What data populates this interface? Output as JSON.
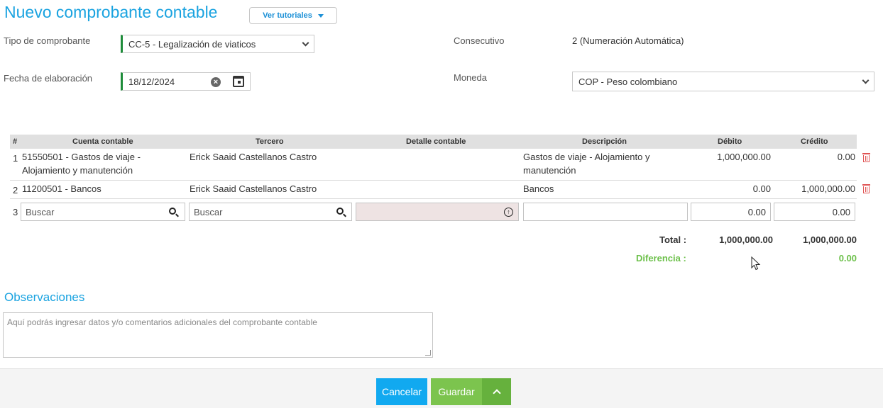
{
  "header": {
    "title": "Nuevo comprobante contable",
    "tutorials_label": "Ver tutoriales"
  },
  "form": {
    "tipo_label": "Tipo de comprobante",
    "tipo_value": "CC-5 - Legalización de viaticos",
    "consecutivo_label": "Consecutivo",
    "consecutivo_value": "2 (Numeración Automática)",
    "fecha_label": "Fecha de elaboración",
    "fecha_value": "18/12/2024",
    "moneda_label": "Moneda",
    "moneda_value": "COP - Peso colombiano"
  },
  "table": {
    "headers": [
      "#",
      "Cuenta contable",
      "Tercero",
      "Detalle contable",
      "Descripción",
      "Débito",
      "Crédito"
    ],
    "rows": [
      {
        "n": "1",
        "cuenta": "51550501 - Gastos de viaje -",
        "cuenta2": "Alojamiento y manutención",
        "tercero": "Erick Saaid Castellanos Castro",
        "desc": "Gastos de viaje - Alojamiento y",
        "desc2": "manutención",
        "debito": "1,000,000.00",
        "credito": "0.00"
      },
      {
        "n": "2",
        "cuenta": "11200501 - Bancos",
        "tercero": "Erick Saaid Castellanos Castro",
        "desc": "Bancos",
        "debito": "0.00",
        "credito": "1,000,000.00"
      }
    ],
    "new_row": {
      "n": "3",
      "cuenta_placeholder": "Buscar",
      "tercero_placeholder": "Buscar",
      "debito": "0.00",
      "credito": "0.00"
    }
  },
  "totals": {
    "total_label": "Total :",
    "total_debito": "1,000,000.00",
    "total_credito": "1,000,000.00",
    "diferencia_label": "Diferencia :",
    "diferencia_value": "0.00"
  },
  "observaciones": {
    "title": "Observaciones",
    "placeholder": "Aquí podrás ingresar datos y/o comentarios adicionales del comprobante contable"
  },
  "footer": {
    "cancel": "Cancelar",
    "save": "Guardar"
  },
  "colors": {
    "accent": "#1aa3e0",
    "save": "#7cc44e",
    "cancel": "#11a9f0",
    "required": "#1e8c3a",
    "delete": "#e05555"
  }
}
